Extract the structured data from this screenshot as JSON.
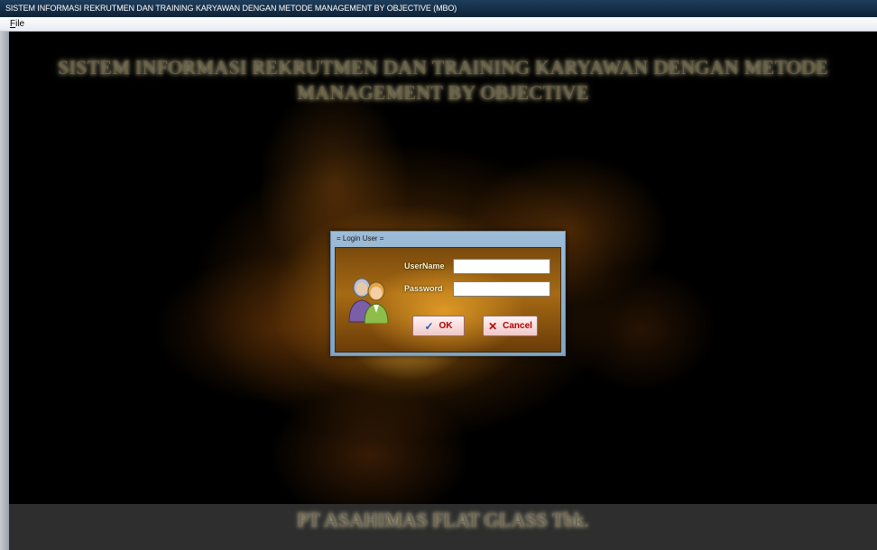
{
  "window": {
    "title": "SISTEM INFORMASI REKRUTMEN DAN TRAINING KARYAWAN DENGAN METODE MANAGEMENT BY OBJECTIVE (MBO)"
  },
  "menubar": {
    "file_hotkey": "F",
    "file_rest": "ile"
  },
  "main": {
    "headline_line1": "SISTEM INFORMASI REKRUTMEN DAN TRAINING KARYAWAN DENGAN METODE",
    "headline_line2": "MANAGEMENT BY OBJECTIVE",
    "company": "PT ASAHIMAS FLAT GLASS Tbk."
  },
  "login": {
    "title": "= Login User =",
    "username_label": "UserName",
    "username_value": "",
    "password_label": "Password",
    "password_value": "",
    "ok_label": "OK",
    "cancel_label": "Cancel",
    "icons": [
      "users-icon",
      "checkmark-icon",
      "x-icon"
    ]
  },
  "colors": {
    "titlebar": "#1e3d5c",
    "dialog_frame": "#9dbcd8",
    "button_text": "#b00000",
    "footer": "#2e2e2e"
  }
}
